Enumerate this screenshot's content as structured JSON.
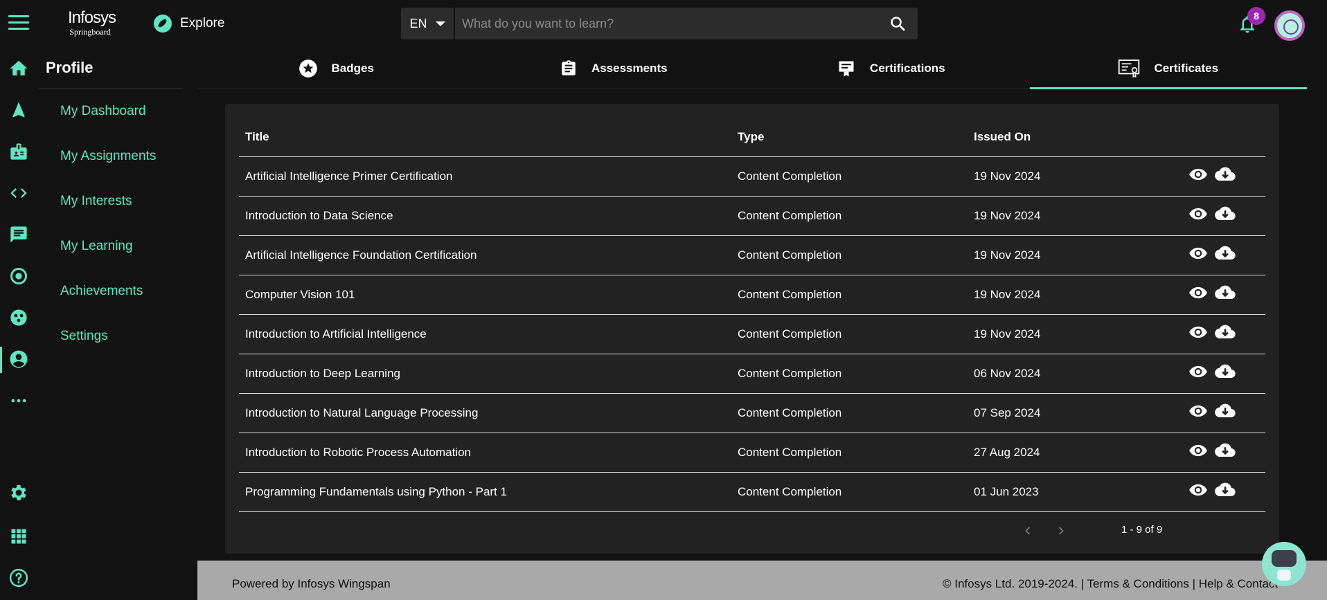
{
  "brand": {
    "line1": "Infosys",
    "line2": "Springboard"
  },
  "header": {
    "explore_label": "Explore",
    "language": "EN",
    "search_placeholder": "What do you want to learn?",
    "notification_count": "8"
  },
  "rail_icons": [
    "home-icon",
    "navigate-icon",
    "badge-icon",
    "code-icon",
    "chat-icon",
    "target-icon",
    "community-icon",
    "profile-icon",
    "more-icon",
    "settings-icon",
    "apps-icon",
    "help-icon"
  ],
  "subnav": {
    "title": "Profile",
    "items": [
      "My Dashboard",
      "My Assignments",
      "My Interests",
      "My Learning",
      "Achievements",
      "Settings"
    ]
  },
  "tabs": [
    {
      "label": "Badges",
      "icon": "star-badge-icon"
    },
    {
      "label": "Assessments",
      "icon": "clipboard-icon"
    },
    {
      "label": "Certifications",
      "icon": "certification-icon"
    },
    {
      "label": "Certificates",
      "icon": "certificate-icon",
      "active": true
    }
  ],
  "table": {
    "headers": {
      "title": "Title",
      "type": "Type",
      "issued": "Issued On"
    },
    "rows": [
      {
        "title": "Artificial Intelligence Primer Certification",
        "type": "Content Completion",
        "issued": "19 Nov 2024"
      },
      {
        "title": "Introduction to Data Science",
        "type": "Content Completion",
        "issued": "19 Nov 2024"
      },
      {
        "title": "Artificial Intelligence Foundation Certification",
        "type": "Content Completion",
        "issued": "19 Nov 2024"
      },
      {
        "title": "Computer Vision 101",
        "type": "Content Completion",
        "issued": "19 Nov 2024"
      },
      {
        "title": "Introduction to Artificial Intelligence",
        "type": "Content Completion",
        "issued": "19 Nov 2024"
      },
      {
        "title": "Introduction to Deep Learning",
        "type": "Content Completion",
        "issued": "06 Nov 2024"
      },
      {
        "title": "Introduction to Natural Language Processing",
        "type": "Content Completion",
        "issued": "07 Sep 2024"
      },
      {
        "title": "Introduction to Robotic Process Automation",
        "type": "Content Completion",
        "issued": "27 Aug 2024"
      },
      {
        "title": "Programming Fundamentals using Python - Part 1",
        "type": "Content Completion",
        "issued": "01 Jun 2023"
      }
    ]
  },
  "pagination": {
    "range": "1 - 9 of 9"
  },
  "footer": {
    "powered": "Powered by Infosys Wingspan",
    "copyright": "© Infosys Ltd. 2019-2024. |",
    "terms": "Terms & Conditions",
    "sep": "|",
    "help": "Help & Contact"
  },
  "colors": {
    "accent": "#5ee6c0",
    "background": "#121212",
    "card": "#222222",
    "footer": "#a9a9a9",
    "badge": "#9c27b0"
  }
}
